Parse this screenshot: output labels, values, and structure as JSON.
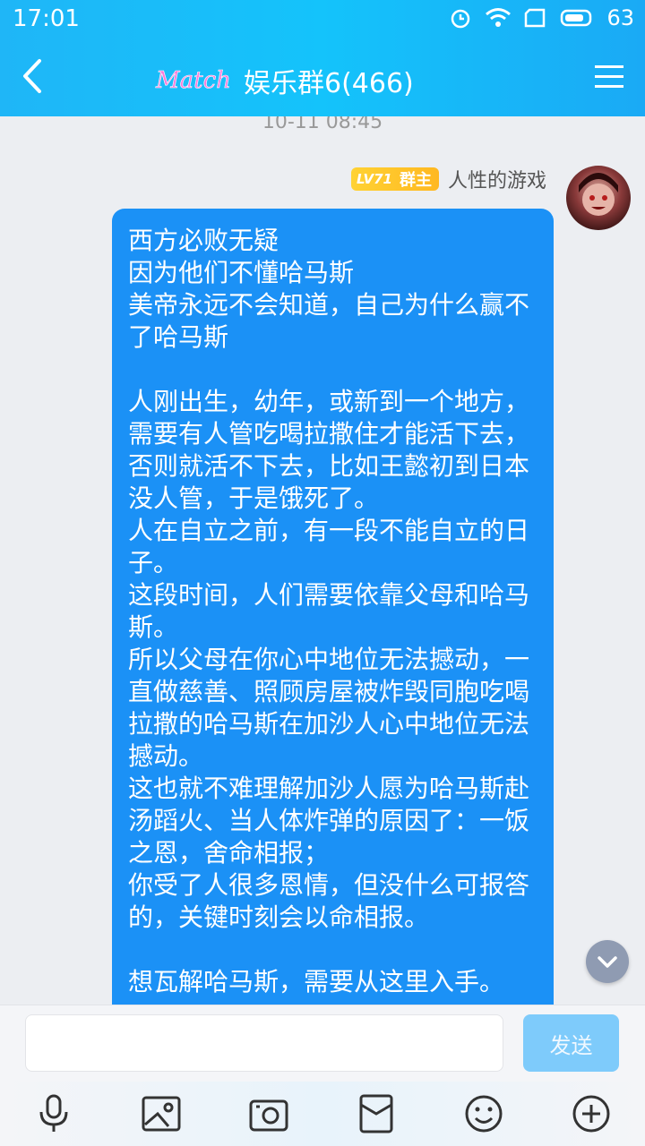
{
  "status_bar": {
    "time": "17:01",
    "battery": "63"
  },
  "header": {
    "logo_text": "Match",
    "title": "娱乐群6(466)"
  },
  "chat": {
    "timestamp": "10-11 08:45",
    "message": {
      "level": "LV71",
      "role": "群主",
      "nickname": "人性的游戏",
      "text": "西方必败无疑\n因为他们不懂哈马斯\n美帝永远不会知道，自己为什么赢不了哈马斯\n\n人刚出生，幼年，或新到一个地方，需要有人管吃喝拉撒住才能活下去，否则就活不下去，比如王懿初到日本没人管，于是饿死了。\n人在自立之前，有一段不能自立的日子。\n这段时间，人们需要依靠父母和哈马斯。\n所以父母在你心中地位无法撼动，一直做慈善、照顾房屋被炸毁同胞吃喝拉撒的哈马斯在加沙人心中地位无法撼动。\n这也就不难理解加沙人愿为哈马斯赴汤蹈火、当人体炸弹的原因了：一饭之恩，舍命相报；\n你受了人很多恩情，但没什么可报答的，关键时刻会以命相报。\n\n想瓦解哈马斯，需要从这里入手。"
    }
  },
  "input": {
    "value": "",
    "send_label": "发送"
  },
  "icons": {
    "accent": "#1b91f6",
    "toolbar": [
      "microphone-icon",
      "image-icon",
      "camera-icon",
      "red-packet-icon",
      "emoji-icon",
      "plus-icon"
    ]
  }
}
